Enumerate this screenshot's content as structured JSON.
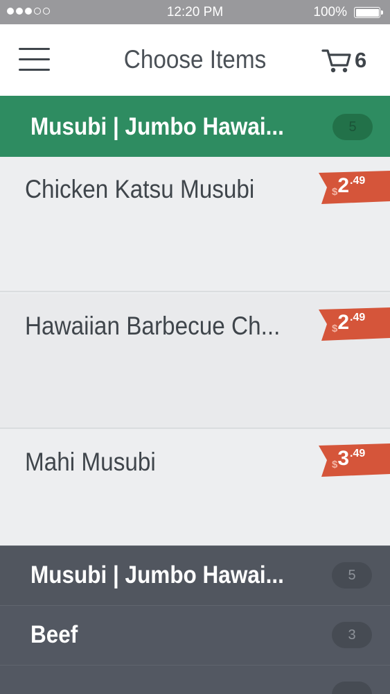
{
  "status_bar": {
    "signal_filled": 3,
    "signal_total": 5,
    "time": "12:20 PM",
    "battery": "100%"
  },
  "header": {
    "title": "Choose Items",
    "cart_count": "6"
  },
  "active_category": {
    "label": "Musubi | Jumbo Hawai...",
    "count": "5"
  },
  "items": [
    {
      "name": "Chicken Katsu Musubi",
      "price_currency": "$",
      "price_dollars": "2",
      "price_cents": ".49"
    },
    {
      "name": "Hawaiian Barbecue Ch...",
      "price_currency": "$",
      "price_dollars": "2",
      "price_cents": ".49"
    },
    {
      "name": "Mahi Musubi",
      "price_currency": "$",
      "price_dollars": "3",
      "price_cents": ".49"
    }
  ],
  "categories": [
    {
      "label": "Musubi | Jumbo Hawai...",
      "count": "5"
    },
    {
      "label": "Beef",
      "count": "3"
    }
  ],
  "colors": {
    "active_category_bg": "#2e8c61",
    "price_tag": "#d5553a",
    "category_bg": "#535862"
  }
}
